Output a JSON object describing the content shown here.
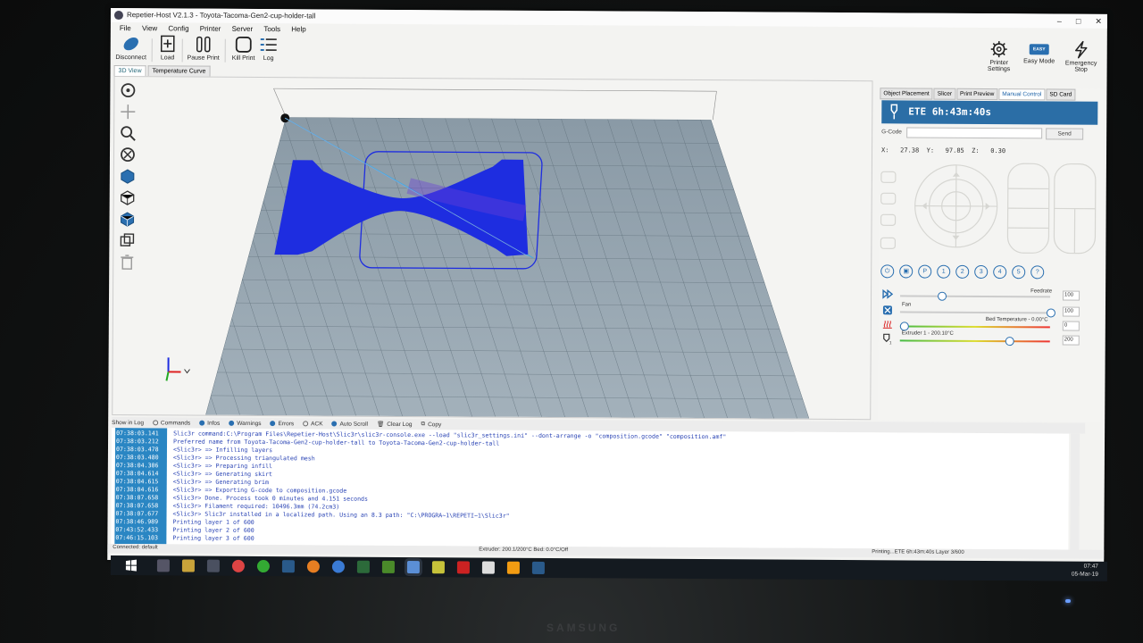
{
  "window": {
    "title": "Repetier-Host V2.1.3 - Toyota-Tacoma-Gen2-cup-holder-tall",
    "minimize": "–",
    "maximize": "□",
    "close": "✕"
  },
  "menu": [
    "File",
    "View",
    "Config",
    "Printer",
    "Server",
    "Tools",
    "Help"
  ],
  "toolbar": {
    "disconnect": "Disconnect",
    "load": "Load",
    "pause_print": "Pause Print",
    "kill_print": "Kill Print",
    "log": "Log",
    "printer_settings": "Printer Settings",
    "easy_mode": "Easy Mode",
    "easy_badge": "EASY",
    "emergency_stop": "Emergency Stop"
  },
  "view_tabs": [
    "3D View",
    "Temperature Curve"
  ],
  "right_tabs": [
    "Object Placement",
    "Slicer",
    "Print Preview",
    "Manual Control",
    "SD Card"
  ],
  "manual_control": {
    "ete": "ETE 6h:43m:40s",
    "gcode_label": "G-Code",
    "send": "Send",
    "coords": "X:   27.38  Y:   97.85  Z:   0.30",
    "buttons": [
      "P",
      "1",
      "2",
      "3",
      "4",
      "5",
      "?"
    ],
    "feedrate": {
      "label": "Feedrate",
      "value": "100"
    },
    "fan": {
      "label": "Fan",
      "value": "100"
    },
    "bed": {
      "label": "Bed Temperature - 0.00°C",
      "value": "0"
    },
    "extruder": {
      "label": "Extruder 1 - 200.10°C",
      "value": "200"
    }
  },
  "log_bar": {
    "show_in_log": "Show in Log",
    "commands": "Commands",
    "infos": "Infos",
    "warnings": "Warnings",
    "errors": "Errors",
    "ack": "ACK",
    "auto_scroll": "Auto Scroll",
    "clear_log": "Clear Log",
    "copy": "Copy"
  },
  "log": [
    {
      "t": "07:38:03.141",
      "m": "Slic3r command:C:\\Program Files\\Repetier-Host\\Slic3r\\slic3r-console.exe --load \"slic3r_settings.ini\" --dont-arrange -o \"composition.gcode\" \"composition.amf\""
    },
    {
      "t": "07:38:03.212",
      "m": "Preferred name from Toyota-Tacoma-Gen2-cup-holder-tall to Toyota-Tacoma-Gen2-cup-holder-tall"
    },
    {
      "t": "07:38:03.478",
      "m": "<Slic3r> => Infilling layers"
    },
    {
      "t": "07:38:03.480",
      "m": "<Slic3r> => Processing triangulated mesh"
    },
    {
      "t": "07:38:04.306",
      "m": "<Slic3r> => Preparing infill"
    },
    {
      "t": "07:38:04.614",
      "m": "<Slic3r> => Generating skirt"
    },
    {
      "t": "07:38:04.615",
      "m": "<Slic3r> => Generating brim"
    },
    {
      "t": "07:38:04.616",
      "m": "<Slic3r> => Exporting G-code to composition.gcode"
    },
    {
      "t": "07:38:07.658",
      "m": "<Slic3r> Done. Process took 0 minutes and 4.151 seconds"
    },
    {
      "t": "07:38:07.658",
      "m": "<Slic3r> Filament required: 10496.3mm (74.2cm3)"
    },
    {
      "t": "07:38:07.677",
      "m": "<Slic3r> Slic3r installed in a localized path. Using an 8.3 path: \"C:\\PROGRA~1\\REPETI~1\\Slic3r\""
    },
    {
      "t": "07:38:46.989",
      "m": "Printing layer 1 of 600"
    },
    {
      "t": "07:43:52.433",
      "m": "Printing layer 2 of 600"
    },
    {
      "t": "07:46:15.103",
      "m": "Printing layer 3 of 600"
    }
  ],
  "status": {
    "connected": "Connected: default",
    "temps": "Extruder: 200.1/200°C Bed: 0.0°C/Off",
    "printing": "Printing...ETE 6h:43m:40s Layer 3/600"
  },
  "taskbar": {
    "time": "07:47",
    "date": "05-Mar-19"
  },
  "monitor_brand": "SAMSUNG",
  "colors": {
    "accent": "#2b6ea6",
    "model": "#1e2de0",
    "bed": "#95a6b1",
    "log_time_bg": "#2a86c3",
    "log_text": "#2b45b5"
  }
}
